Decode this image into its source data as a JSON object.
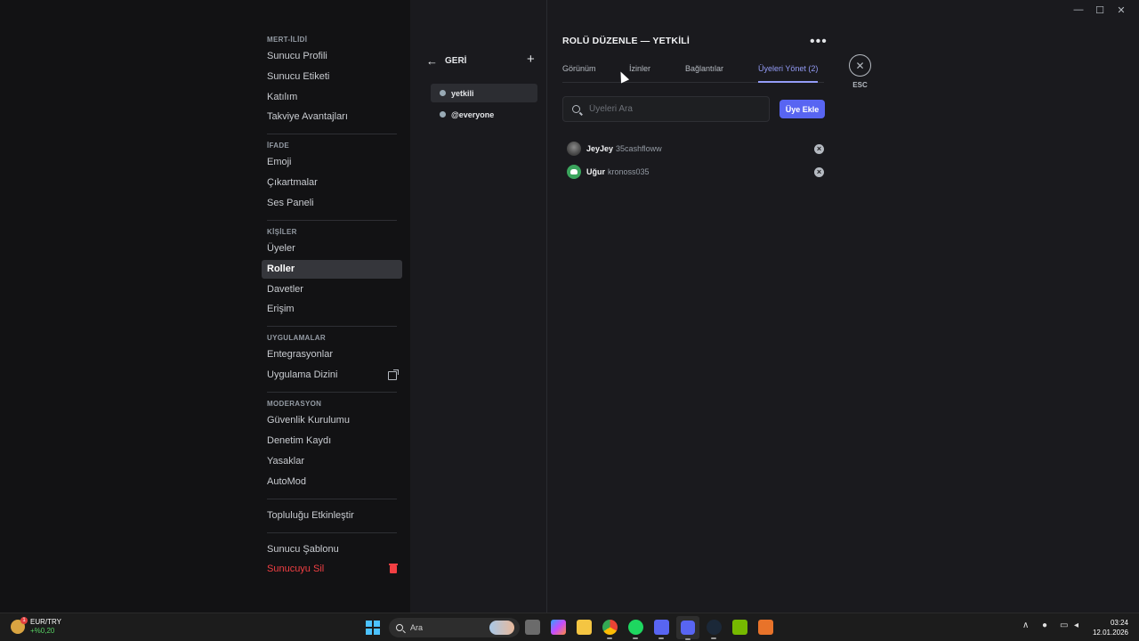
{
  "window_controls": {
    "minimize": "—",
    "maximize": "☐",
    "close": "✕"
  },
  "sidebar": {
    "sections": [
      {
        "header": "MERT-İLİDİ",
        "items": [
          "Sunucu Profili",
          "Sunucu Etiketi",
          "Katılım",
          "Takviye Avantajları"
        ]
      },
      {
        "header": "İFADE",
        "items": [
          "Emoji",
          "Çıkartmalar",
          "Ses Paneli"
        ]
      },
      {
        "header": "KİŞİLER",
        "items": [
          "Üyeler",
          "Roller",
          "Davetler",
          "Erişim"
        ]
      },
      {
        "header": "UYGULAMALAR",
        "items": [
          "Entegrasyonlar",
          "Uygulama Dizini"
        ]
      },
      {
        "header": "MODERASYON",
        "items": [
          "Güvenlik Kurulumu",
          "Denetim Kaydı",
          "Yasaklar",
          "AutoMod"
        ]
      }
    ],
    "community": "Topluluğu Etkinleştir",
    "template": "Sunucu Şablonu",
    "delete": "Sunucuyu Sil",
    "active_item": "Roller"
  },
  "roles": {
    "back_label": "GERİ",
    "add_icon": "plus-icon",
    "items": [
      {
        "name": "yetkili",
        "color": "#99aab5",
        "active": true
      },
      {
        "name": "@everyone",
        "color": "#99aab5",
        "active": false
      }
    ]
  },
  "content": {
    "title": "ROLÜ DÜZENLE — YETKİLİ",
    "more_icon": "more-icon",
    "tabs": [
      "Görünüm",
      "İzinler",
      "Bağlantılar",
      "Üyeleri Yönet (2)"
    ],
    "active_tab": "Üyeleri Yönet (2)",
    "search_placeholder": "Üyeleri Ara",
    "add_member_label": "Üye Ekle",
    "members": [
      {
        "display_name": "JeyJey",
        "username": "35cashfloww",
        "avatar": "photo"
      },
      {
        "display_name": "Uğur",
        "username": "kronoss035",
        "avatar": "discord-default"
      }
    ],
    "close_label": "ESC"
  },
  "accent_color": "#5865f2",
  "taskbar": {
    "ticker_label": "EUR/TRY",
    "ticker_change": "+%0,20",
    "ticker_badge": "1",
    "search_label": "Ara",
    "time": "03:24",
    "date": "12.01.2026",
    "apps": [
      "file-explorer-icon",
      "copilot-icon",
      "folder-icon",
      "chrome-icon",
      "spotify-icon",
      "discord-icon",
      "discord-ptb-icon",
      "steam-icon",
      "nvidia-icon",
      "app-icon"
    ]
  }
}
